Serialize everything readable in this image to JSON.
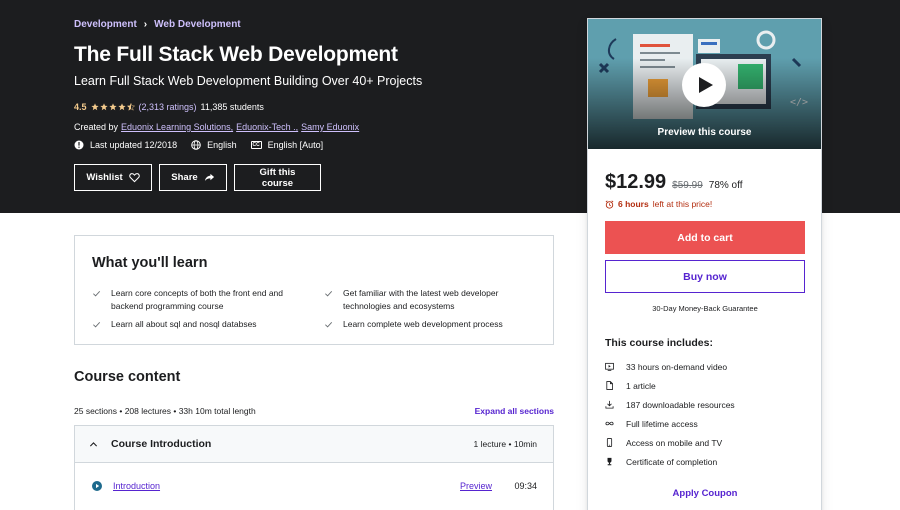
{
  "breadcrumb": {
    "items": [
      "Development",
      "Web Development"
    ],
    "separator": "›"
  },
  "course": {
    "title": "The Full Stack Web Development",
    "subtitle": "Learn Full Stack Web Development Building Over 40+ Projects",
    "rating": "4.5",
    "rating_value": 4.5,
    "ratings_count": "(2,313 ratings)",
    "students": "11,385 students",
    "created_by_label": "Created by",
    "instructors": [
      "Eduonix Learning Solutions,",
      "Eduonix-Tech .,",
      "Samy Eduonix"
    ],
    "last_updated": "Last updated 12/2018",
    "language": "English",
    "captions": "English [Auto]"
  },
  "header_buttons": {
    "wishlist": "Wishlist",
    "share": "Share",
    "gift": "Gift this course"
  },
  "sidebar": {
    "preview_label": "Preview this course",
    "price": "$12.99",
    "original_price": "$59.99",
    "discount": "78% off",
    "timer_bold": "6 hours",
    "timer_rest": "left at this price!",
    "add_to_cart": "Add to cart",
    "buy_now": "Buy now",
    "guarantee": "30-Day Money-Back Guarantee",
    "includes_title": "This course includes:",
    "includes": [
      {
        "icon": "video-icon",
        "text": "33 hours on-demand video"
      },
      {
        "icon": "file-icon",
        "text": "1 article"
      },
      {
        "icon": "download-icon",
        "text": "187 downloadable resources"
      },
      {
        "icon": "infinity-icon",
        "text": "Full lifetime access"
      },
      {
        "icon": "mobile-icon",
        "text": "Access on mobile and TV"
      },
      {
        "icon": "trophy-icon",
        "text": "Certificate of completion"
      }
    ],
    "apply_coupon": "Apply Coupon"
  },
  "learn": {
    "title": "What you'll learn",
    "items": [
      "Learn core concepts of both the front end and backend programming course",
      "Get familiar with the latest web developer technologies and ecosystems",
      "Learn all about sql and nosql databses",
      "Learn complete web development process"
    ]
  },
  "content": {
    "title": "Course content",
    "stats": "25 sections • 208 lectures • 33h 10m total length",
    "expand_all": "Expand all sections",
    "section": {
      "title": "Course Introduction",
      "meta": "1 lecture • 10min"
    },
    "lecture": {
      "title": "Introduction",
      "preview": "Preview",
      "duration": "09:34"
    }
  },
  "colors": {
    "hero_bg": "#1c1d1f",
    "accent": "#5624d0",
    "cart": "#ec5252",
    "link_light": "#cec0fc",
    "star": "#f3ca8c",
    "alert": "#b32d0f"
  }
}
